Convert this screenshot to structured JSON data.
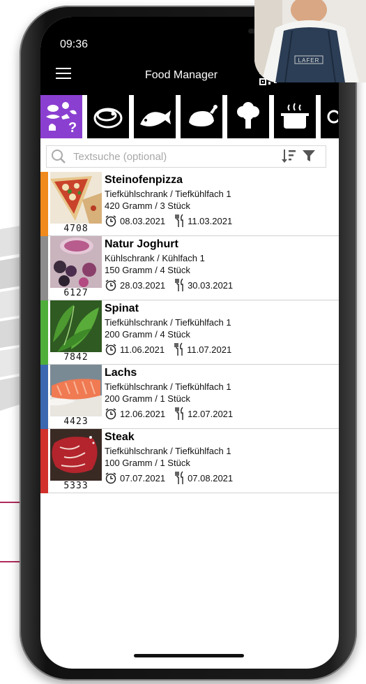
{
  "status": {
    "time": "09:36"
  },
  "header": {
    "title": "Food Manager"
  },
  "chef": {
    "apron_text": "LAFER"
  },
  "categories": [
    {
      "name": "all",
      "active": true
    },
    {
      "name": "meat",
      "active": false
    },
    {
      "name": "fish",
      "active": false
    },
    {
      "name": "poultry",
      "active": false
    },
    {
      "name": "vegetables",
      "active": false
    },
    {
      "name": "soup",
      "active": false
    }
  ],
  "search": {
    "placeholder": "Textsuche (optional)"
  },
  "items": [
    {
      "name": "Steinofenpizza",
      "location": "Tiefkühlschrank / Tiefkühlfach 1",
      "quantity": "420 Gramm / 3 Stück",
      "date_stored": "08.03.2021",
      "date_best_before": "11.03.2021",
      "code": "4708",
      "color": "#f08a1c"
    },
    {
      "name": "Natur Joghurt",
      "location": "Kühlschrank / Kühlfach 1",
      "quantity": "150 Gramm / 4 Stück",
      "date_stored": "28.03.2021",
      "date_best_before": "30.03.2021",
      "code": "6127",
      "color": "#8c8c8c"
    },
    {
      "name": "Spinat",
      "location": "Tiefkühlschrank / Tiefkühlfach 1",
      "quantity": "200 Gramm / 4 Stück",
      "date_stored": "11.06.2021",
      "date_best_before": "11.07.2021",
      "code": "7842",
      "color": "#4fae3a"
    },
    {
      "name": "Lachs",
      "location": "Tiefkühlschrank / Tiefkühlfach 1",
      "quantity": "200 Gramm / 1 Stück",
      "date_stored": "12.06.2021",
      "date_best_before": "12.07.2021",
      "code": "4423",
      "color": "#3a67b0"
    },
    {
      "name": "Steak",
      "location": "Tiefkühlschrank / Tiefkühlfach 1",
      "quantity": "100 Gramm / 1 Stück",
      "date_stored": "07.07.2021",
      "date_best_before": "07.08.2021",
      "code": "5333",
      "color": "#d1302b"
    }
  ],
  "colors": {
    "accent": "#8b3fd1",
    "topbar": "#000000"
  }
}
